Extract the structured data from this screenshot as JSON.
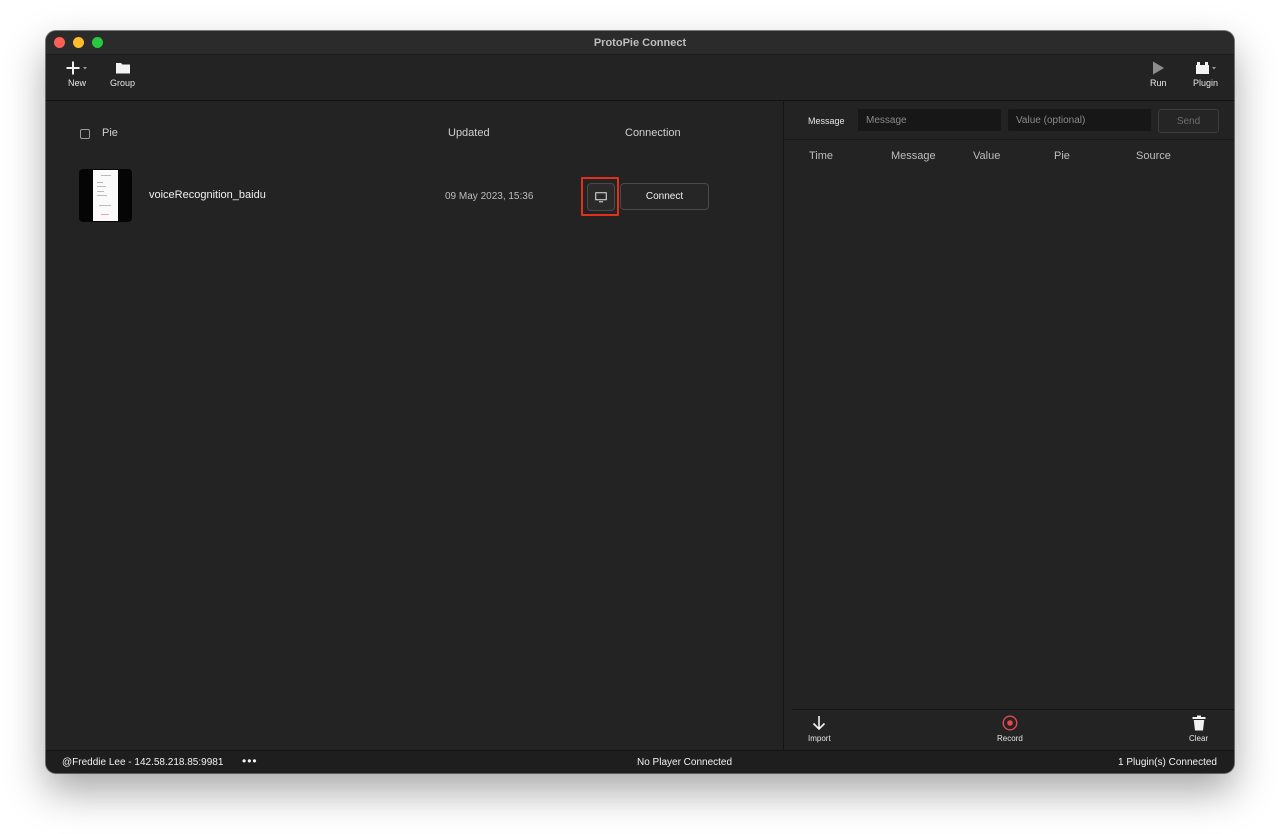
{
  "window": {
    "title": "ProtoPie Connect"
  },
  "toolbar": {
    "new_label": "New",
    "group_label": "Group",
    "run_label": "Run",
    "plugin_label": "Plugin"
  },
  "pies": {
    "headers": {
      "pie": "Pie",
      "updated": "Updated",
      "connection": "Connection"
    },
    "rows": [
      {
        "name": "voiceRecognition_baidu",
        "updated": "09 May 2023, 15:36",
        "connect_label": "Connect"
      }
    ]
  },
  "messages": {
    "label": "Message",
    "message_placeholder": "Message",
    "value_placeholder": "Value (optional)",
    "send_label": "Send",
    "columns": [
      "Time",
      "Message",
      "Value",
      "Pie",
      "Source"
    ]
  },
  "log_actions": {
    "import_label": "Import",
    "record_label": "Record",
    "clear_label": "Clear"
  },
  "status": {
    "user": "@Freddie Lee - 142.58.218.85:9981",
    "more": "•••",
    "player": "No Player Connected",
    "plugins": "1 Plugin(s) Connected"
  },
  "colors": {
    "background": "#232323",
    "highlight": "#e0301e",
    "record": "#e5484d"
  }
}
